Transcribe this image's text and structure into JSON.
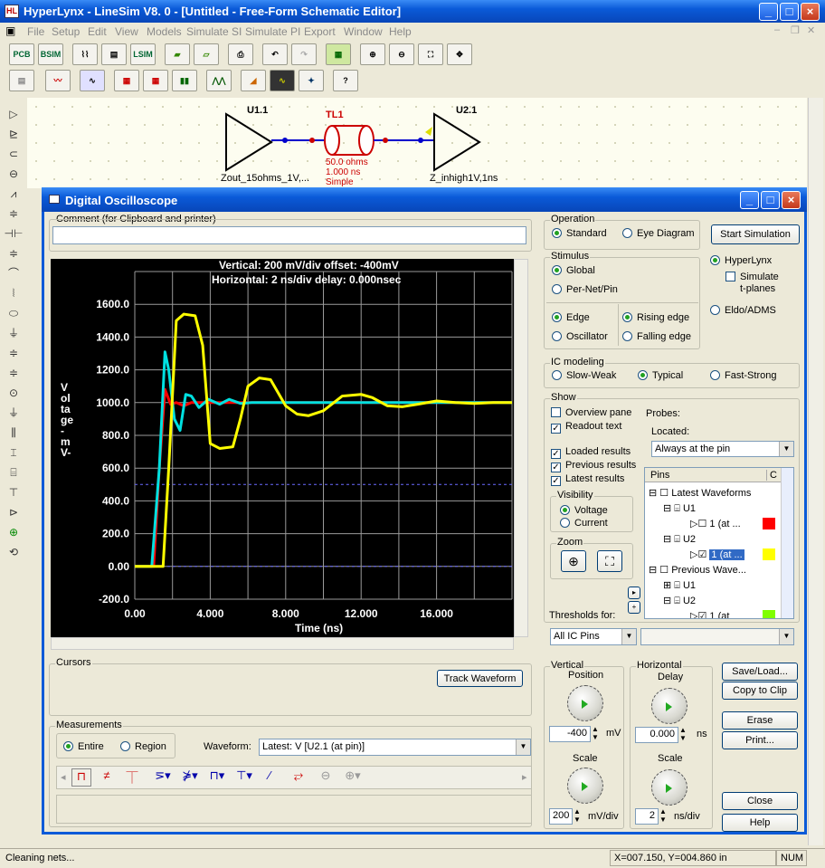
{
  "app": {
    "title": "HyperLynx - LineSim V8. 0 - [Untitled - Free-Form Schematic Editor]",
    "icon": "app-icon"
  },
  "menu": [
    "File",
    "Setup",
    "Edit",
    "View",
    "Models",
    "Simulate SI",
    "Simulate PI",
    "Export",
    "Window",
    "Help"
  ],
  "toolbar1": [
    "PCB",
    "BSIM",
    "",
    "",
    "LSIM"
  ],
  "schematic": {
    "u1": "U1.1",
    "u1_model": "Zout_15ohms_1V,...",
    "tl": "TL1",
    "tl_ohms": "50.0 ohms",
    "tl_ns": "1.000 ns",
    "tl_type": "Simple",
    "u2": "U2.1",
    "u2_model": "Z_inhigh1V,1ns"
  },
  "osc": {
    "title": "Digital Oscilloscope",
    "comment_label": "Comment (for Clipboard and printer)",
    "comment_value": "",
    "readout1": "Vertical: 200 mV/div  offset: -400mV",
    "readout2": "Horizontal: 2 ns/div  delay: 0.000nsec",
    "operation": {
      "label": "Operation",
      "standard": "Standard",
      "eye": "Eye Diagram"
    },
    "start_sim": "Start Simulation",
    "stimulus": {
      "label": "Stimulus",
      "global": "Global",
      "pernet": "Per-Net/Pin",
      "edge": "Edge",
      "osc": "Oscillator",
      "rising": "Rising edge",
      "falling": "Falling edge"
    },
    "engine": {
      "hyperlynx": "HyperLynx",
      "simulate": "Simulate",
      "tplanes": "t-planes",
      "eldo": "Eldo/ADMS"
    },
    "ic": {
      "label": "IC modeling",
      "slow": "Slow-Weak",
      "typical": "Typical",
      "fast": "Fast-Strong"
    },
    "show": {
      "label": "Show",
      "overview": "Overview pane",
      "readout": "Readout text",
      "loaded": "Loaded results",
      "previous": "Previous results",
      "latest": "Latest results",
      "probes": "Probes:",
      "located": "Located:",
      "located_value": "Always at the pin"
    },
    "visibility": {
      "label": "Visibility",
      "voltage": "Voltage",
      "current": "Current"
    },
    "zoom_label": "Zoom",
    "pins_header": "Pins",
    "pins_col2": "C",
    "tree": [
      {
        "text": "Latest Waveforms"
      },
      {
        "text": "U1"
      },
      {
        "text": "1 (at ..."
      },
      {
        "text": "U2"
      },
      {
        "text": "1 (at ..."
      },
      {
        "text": "Previous Wave..."
      },
      {
        "text": "U1"
      },
      {
        "text": "U2"
      },
      {
        "text": "1 (at"
      }
    ],
    "thresholds_label": "Thresholds for:",
    "thresholds_value": "All IC Pins",
    "cursors_label": "Cursors",
    "track": "Track Waveform",
    "measurements_label": "Measurements",
    "entire": "Entire",
    "region": "Region",
    "waveform_label": "Waveform:",
    "waveform_value": "Latest: V [U2.1 (at pin)]",
    "vertical": {
      "label": "Vertical",
      "position": "Position",
      "pos_value": "-400",
      "pos_unit": "mV",
      "scale": "Scale",
      "scale_value": "200",
      "scale_unit": "mV/div"
    },
    "horizontal": {
      "label": "Horizontal",
      "delay": "Delay",
      "delay_value": "0.000",
      "delay_unit": "ns",
      "scale": "Scale",
      "scale_value": "2",
      "scale_unit": "ns/div"
    },
    "buttons": {
      "save": "Save/Load...",
      "copy": "Copy to Clip",
      "erase": "Erase",
      "print": "Print...",
      "close": "Close",
      "help": "Help"
    }
  },
  "status": {
    "left": "Cleaning nets...",
    "coords": "X=007.150, Y=004.860 in",
    "num": "NUM"
  },
  "colors": {
    "red": "#ff0000",
    "yellow": "#ffff00",
    "cyan": "#00e0e0",
    "green": "#80ff00"
  },
  "chart_data": {
    "type": "line",
    "xlabel": "Time  (ns)",
    "ylabel": "Voltage -mV-",
    "xlim": [
      0,
      20
    ],
    "ylim": [
      -200,
      1800
    ],
    "xticks": [
      "0.00",
      "4.000",
      "8.000",
      "12.000",
      "16.000"
    ],
    "yticks": [
      "1600.0",
      "1400.0",
      "1200.0",
      "1000.0",
      "800.0",
      "600.0",
      "400.0",
      "200.0",
      "0.00",
      "-200.0"
    ],
    "series": [
      {
        "color": "red",
        "x": [
          0,
          0.4,
          1.0,
          1.3,
          1.6,
          1.9,
          2.2,
          2.6,
          3.0,
          4.0,
          20
        ],
        "y": [
          0,
          0,
          0,
          600,
          1080,
          990,
          1000,
          980,
          1000,
          1000,
          1000
        ]
      },
      {
        "color": "cyan",
        "x": [
          0,
          0.4,
          0.9,
          1.3,
          1.6,
          1.8,
          2.1,
          2.4,
          2.7,
          3.0,
          3.4,
          3.9,
          4.5,
          5.0,
          5.6,
          6.2,
          7,
          8,
          20
        ],
        "y": [
          0,
          0,
          0,
          600,
          1310,
          1200,
          900,
          830,
          1050,
          1040,
          970,
          1020,
          990,
          1020,
          995,
          1000,
          1000,
          1000,
          1000
        ]
      },
      {
        "color": "yellow",
        "x": [
          0,
          1.2,
          1.5,
          1.8,
          2.2,
          2.6,
          3.2,
          3.6,
          4.0,
          4.5,
          5.2,
          5.6,
          6.0,
          6.6,
          7.2,
          8.0,
          8.6,
          9.2,
          10,
          11.0,
          12.0,
          12.6,
          13.4,
          14.2,
          15,
          16,
          17,
          18,
          19,
          20
        ],
        "y": [
          0,
          0,
          0,
          600,
          1500,
          1540,
          1530,
          1350,
          750,
          720,
          730,
          900,
          1100,
          1150,
          1140,
          980,
          930,
          920,
          950,
          1040,
          1050,
          1030,
          980,
          975,
          990,
          1010,
          1000,
          995,
          1000,
          1000
        ]
      }
    ],
    "guides": [
      {
        "y": 500,
        "style": "dash"
      },
      {
        "y": 0,
        "style": "dash"
      }
    ]
  }
}
